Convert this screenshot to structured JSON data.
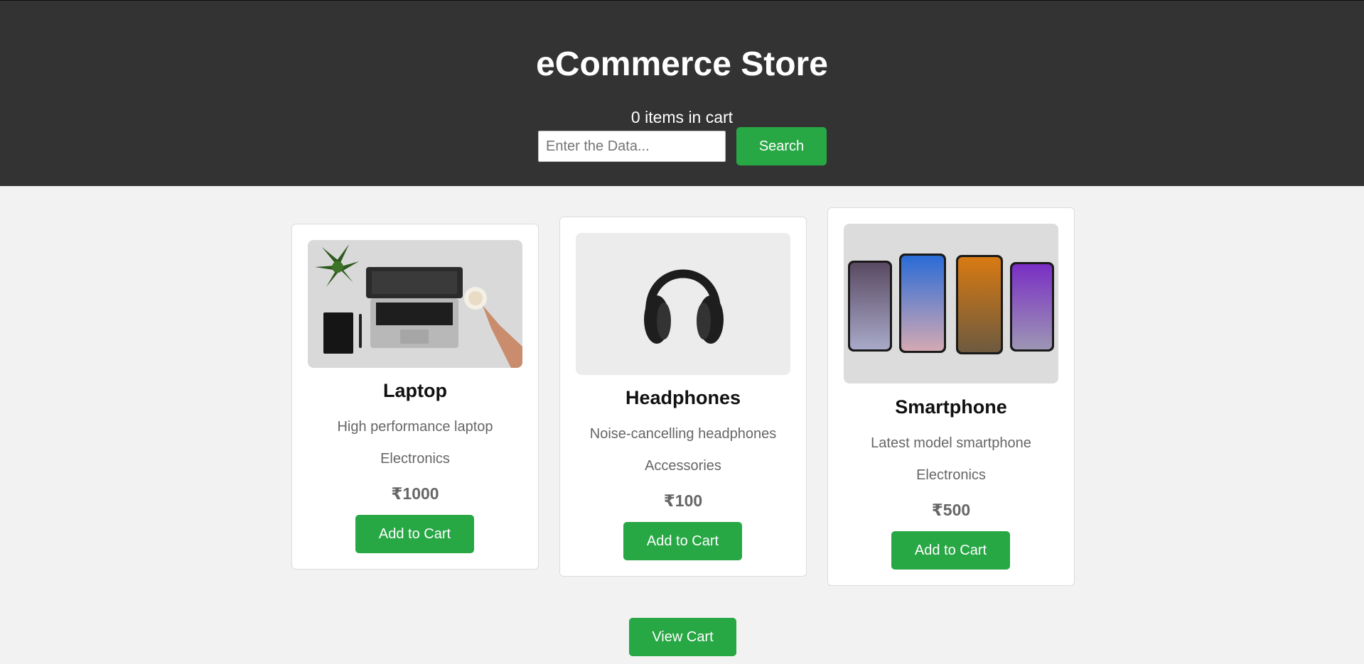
{
  "header": {
    "title": "eCommerce Store",
    "cart_count": "0 items in cart",
    "search_placeholder": "Enter the Data...",
    "search_label": "Search"
  },
  "products": [
    {
      "name": "Laptop",
      "description": "High performance laptop",
      "category": "Electronics",
      "price": "₹1000",
      "add_label": "Add to Cart",
      "image": "laptop-photo"
    },
    {
      "name": "Headphones",
      "description": "Noise-cancelling headphones",
      "category": "Accessories",
      "price": "₹100",
      "add_label": "Add to Cart",
      "image": "headphones-photo"
    },
    {
      "name": "Smartphone",
      "description": "Latest model smartphone",
      "category": "Electronics",
      "price": "₹500",
      "add_label": "Add to Cart",
      "image": "smartphones-photo"
    }
  ],
  "footer": {
    "view_cart_label": "View Cart"
  },
  "colors": {
    "header_bg": "#333333",
    "accent": "#28a745",
    "page_bg": "#f2f2f2"
  }
}
